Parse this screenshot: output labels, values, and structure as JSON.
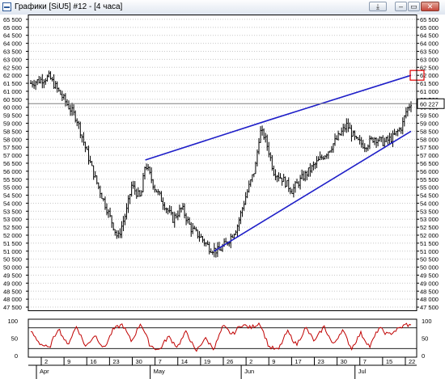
{
  "window": {
    "title": "Графики [SiU5] #12 - [4 часа]",
    "buttons": {
      "download": "⤓",
      "minimize": "–",
      "restore": "▭",
      "close": "✕"
    }
  },
  "chart_data": {
    "type": "candlestick",
    "instrument": "SiU5",
    "timeframe": "4 часа",
    "ylim": [
      47300,
      65800
    ],
    "y_ticks": [
      "65 500",
      "65 000",
      "64 500",
      "64 000",
      "63 500",
      "63 000",
      "62 500",
      "62 000",
      "61 500",
      "61 000",
      "60 500",
      "60 000",
      "59 500",
      "59 000",
      "58 500",
      "58 000",
      "57 500",
      "57 000",
      "56 500",
      "56 000",
      "55 500",
      "55 000",
      "54 500",
      "54 000",
      "53 500",
      "53 000",
      "52 500",
      "52 000",
      "51 500",
      "51 000",
      "50 500",
      "50 000",
      "49 500",
      "49 000",
      "48 500",
      "48 000",
      "47 500"
    ],
    "x_day_ticks": [
      "2",
      "9",
      "16",
      "23",
      "30",
      "7",
      "14",
      "19",
      "26",
      "2",
      "9",
      "17",
      "23",
      "30",
      "7",
      "15",
      "22"
    ],
    "x_month_labels": [
      "Apr",
      "May",
      "Jun",
      "Jul"
    ],
    "current_price_label": "60 227",
    "current_price": 60227,
    "price_path": [
      {
        "x": 0,
        "y": 61500
      },
      {
        "x": 4,
        "y": 61900
      },
      {
        "x": 7,
        "y": 60600
      },
      {
        "x": 10,
        "y": 59300
      },
      {
        "x": 12,
        "y": 57400
      },
      {
        "x": 14,
        "y": 55600
      },
      {
        "x": 16,
        "y": 54100
      },
      {
        "x": 18,
        "y": 52600
      },
      {
        "x": 19,
        "y": 51800
      },
      {
        "x": 21,
        "y": 53600
      },
      {
        "x": 22,
        "y": 55100
      },
      {
        "x": 24,
        "y": 54300
      },
      {
        "x": 25,
        "y": 56500
      },
      {
        "x": 27,
        "y": 55000
      },
      {
        "x": 29,
        "y": 54000
      },
      {
        "x": 31,
        "y": 53000
      },
      {
        "x": 33,
        "y": 53700
      },
      {
        "x": 35,
        "y": 52400
      },
      {
        "x": 37,
        "y": 51900
      },
      {
        "x": 39,
        "y": 51200
      },
      {
        "x": 41,
        "y": 51000
      },
      {
        "x": 43,
        "y": 51600
      },
      {
        "x": 45,
        "y": 52500
      },
      {
        "x": 47,
        "y": 54500
      },
      {
        "x": 49,
        "y": 56200
      },
      {
        "x": 50,
        "y": 58500
      },
      {
        "x": 51,
        "y": 58200
      },
      {
        "x": 52,
        "y": 57200
      },
      {
        "x": 53,
        "y": 56000
      },
      {
        "x": 55,
        "y": 55500
      },
      {
        "x": 57,
        "y": 54800
      },
      {
        "x": 59,
        "y": 55500
      },
      {
        "x": 62,
        "y": 56400
      },
      {
        "x": 65,
        "y": 57300
      },
      {
        "x": 67,
        "y": 58100
      },
      {
        "x": 69,
        "y": 58900
      },
      {
        "x": 71,
        "y": 57900
      },
      {
        "x": 73,
        "y": 57600
      },
      {
        "x": 75,
        "y": 58100
      },
      {
        "x": 77,
        "y": 57800
      },
      {
        "x": 79,
        "y": 58100
      },
      {
        "x": 81,
        "y": 58800
      },
      {
        "x": 82,
        "y": 59800
      },
      {
        "x": 83,
        "y": 60300
      }
    ],
    "trendlines": [
      {
        "name": "upper",
        "points": [
          {
            "x": 25,
            "y": 56700
          },
          {
            "x": 52,
            "y": 59200
          },
          {
            "x": 83,
            "y": 62000
          }
        ]
      },
      {
        "name": "lower",
        "points": [
          {
            "x": 40,
            "y": 51000
          },
          {
            "x": 83,
            "y": 58500
          }
        ]
      }
    ],
    "horizontal_level": 60227,
    "marker_level": 62000,
    "oscillator": {
      "ylim": [
        -5,
        105
      ],
      "ticks": [
        "100",
        "50",
        "0"
      ],
      "levels": [
        20,
        80
      ],
      "path": [
        {
          "x": 0,
          "y": 70
        },
        {
          "x": 2,
          "y": 35
        },
        {
          "x": 4,
          "y": 20
        },
        {
          "x": 6,
          "y": 80
        },
        {
          "x": 8,
          "y": 30
        },
        {
          "x": 10,
          "y": 85
        },
        {
          "x": 12,
          "y": 25
        },
        {
          "x": 14,
          "y": 60
        },
        {
          "x": 16,
          "y": 20
        },
        {
          "x": 18,
          "y": 75
        },
        {
          "x": 20,
          "y": 90
        },
        {
          "x": 22,
          "y": 40
        },
        {
          "x": 24,
          "y": 95
        },
        {
          "x": 26,
          "y": 30
        },
        {
          "x": 28,
          "y": 15
        },
        {
          "x": 30,
          "y": 55
        },
        {
          "x": 32,
          "y": 25
        },
        {
          "x": 34,
          "y": 70
        },
        {
          "x": 36,
          "y": 10
        },
        {
          "x": 38,
          "y": 50
        },
        {
          "x": 40,
          "y": 20
        },
        {
          "x": 42,
          "y": 85
        },
        {
          "x": 44,
          "y": 60
        },
        {
          "x": 46,
          "y": 90
        },
        {
          "x": 48,
          "y": 80
        },
        {
          "x": 50,
          "y": 95
        },
        {
          "x": 52,
          "y": 25
        },
        {
          "x": 54,
          "y": 15
        },
        {
          "x": 56,
          "y": 70
        },
        {
          "x": 58,
          "y": 30
        },
        {
          "x": 60,
          "y": 80
        },
        {
          "x": 62,
          "y": 40
        },
        {
          "x": 64,
          "y": 85
        },
        {
          "x": 66,
          "y": 30
        },
        {
          "x": 68,
          "y": 75
        },
        {
          "x": 70,
          "y": 20
        },
        {
          "x": 72,
          "y": 65
        },
        {
          "x": 74,
          "y": 25
        },
        {
          "x": 76,
          "y": 80
        },
        {
          "x": 78,
          "y": 60
        },
        {
          "x": 80,
          "y": 75
        },
        {
          "x": 82,
          "y": 90
        },
        {
          "x": 83,
          "y": 85
        }
      ]
    }
  },
  "colors": {
    "trendline": "#1f1fc8",
    "oscillator": "#c00000",
    "marker": "#e00000",
    "grid": "#c8c8c8",
    "candles": "#000000"
  }
}
